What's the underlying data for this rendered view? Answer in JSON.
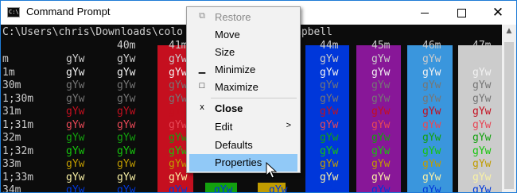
{
  "window": {
    "title": "Command Prompt",
    "app_icon": "cmd-icon",
    "app_icon_text": "C:\\"
  },
  "title_buttons": {
    "minimize": "minimize-icon",
    "maximize": "maximize-icon",
    "close": "close-icon"
  },
  "console": {
    "path_line": "C:\\Users\\chris\\Downloads\\colo",
    "path_line_tail": "mpbell",
    "header_labels": [
      "40m",
      "41m",
      "44m",
      "45m",
      "46m",
      "47m"
    ],
    "row_labels": [
      "m",
      "1m",
      "30m",
      "1;30m",
      "31m",
      "1;31m",
      "32m",
      "1;32m",
      "33m",
      "1;33m",
      "34m"
    ],
    "sample_text": "gYw",
    "fg_colors": [
      "#cccccc",
      "#f2f2f2",
      "#767676",
      "#767676",
      "#c50f1f",
      "#e74856",
      "#13a10e",
      "#16c60c",
      "#c19c00",
      "#f9f1a5",
      "#0037da"
    ],
    "bg_colors": {
      "40m": "#0c0c0c",
      "41m": "#c50f1f",
      "42m": "#13a10e",
      "43m": "#c19c00",
      "44m": "#0037da",
      "45m": "#881798",
      "46m": "#3a96dd",
      "47m": "#cccccc"
    },
    "partial_bg_colors": {
      "42m": "#13a10e",
      "43m": "#c19c00"
    }
  },
  "context_menu": {
    "items": [
      {
        "label": "Restore",
        "icon": "restore-icon",
        "icon_glyph": "⧉",
        "disabled": true
      },
      {
        "label": "Move"
      },
      {
        "label": "Size"
      },
      {
        "label": "Minimize",
        "icon": "minimize-icon",
        "icon_glyph": "▁"
      },
      {
        "label": "Maximize",
        "icon": "maximize-icon",
        "icon_glyph": "□"
      },
      {
        "label": "Close",
        "icon": "close-icon",
        "icon_glyph": "x",
        "bold": true
      },
      {
        "label": "Edit",
        "submenu": true
      },
      {
        "label": "Defaults"
      },
      {
        "label": "Properties",
        "highlighted": true
      }
    ],
    "submenu_arrow": ">"
  }
}
